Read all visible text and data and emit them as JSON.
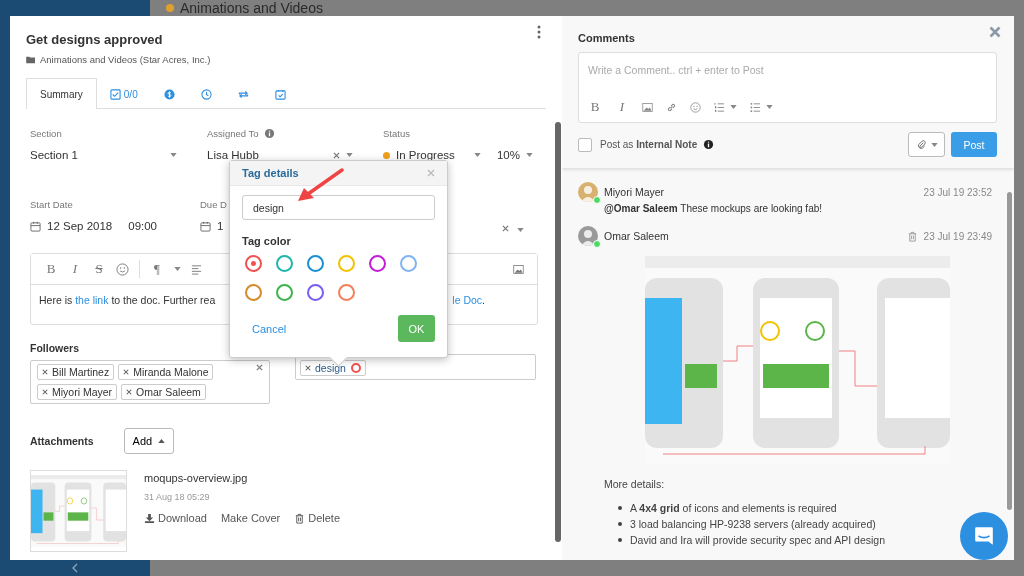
{
  "background": {
    "project_title": "Animations and Videos"
  },
  "task": {
    "title": "Get designs approved",
    "breadcrumb": "Animations and Videos (Star Acres, Inc.)",
    "tabs": [
      {
        "kind": "summary",
        "label": "Summary",
        "selected": true
      },
      {
        "kind": "checklist",
        "label": "0/0",
        "selected": false
      },
      {
        "kind": "billing",
        "selected": false
      },
      {
        "kind": "time",
        "selected": false
      },
      {
        "kind": "recurrence",
        "selected": false
      },
      {
        "kind": "schedule",
        "selected": false
      }
    ],
    "fields": [
      {
        "kind": "select",
        "label": "Section",
        "value": "Section 1"
      },
      {
        "kind": "assignee",
        "label": "Assigned To",
        "value": "Lisa Hubb"
      },
      {
        "kind": "status",
        "label": "Status",
        "value": "In Progress",
        "color": "#f0a020",
        "percent": "10%"
      }
    ],
    "dates": [
      {
        "label": "Start Date",
        "date": "12 Sep 2018",
        "time": "09:00"
      },
      {
        "label": "Due D",
        "date": "1"
      }
    ],
    "editor": {
      "glyphs": [
        "B",
        "I",
        "S"
      ],
      "paragraph": "¶",
      "before": "Here is ",
      "link": "the link",
      "after": " to the doc. Further rea",
      "tail_link": "le Doc",
      "tail": "."
    },
    "followers": {
      "label": "Followers",
      "people": [
        "Bill Martinez",
        "Miranda Malone",
        "Miyori Mayer",
        "Omar Saleem"
      ]
    },
    "tags": [
      {
        "name": "design",
        "color": "#f0524f"
      }
    ],
    "attachments": {
      "label": "Attachments",
      "add_button": "Add",
      "files": [
        {
          "name": "moqups-overview.jpg",
          "date": "31 Aug 18 05:29",
          "actions": [
            {
              "kind": "download",
              "label": "Download"
            },
            {
              "kind": "cover",
              "label": "Make Cover"
            },
            {
              "kind": "delete",
              "label": "Delete"
            }
          ]
        }
      ]
    }
  },
  "tag_popup": {
    "title": "Tag details",
    "value": "design",
    "color_label": "Tag color",
    "colors": [
      {
        "color": "#f0524f",
        "selected": true
      },
      {
        "color": "#1fb5a8",
        "selected": false
      },
      {
        "color": "#1a8ed1",
        "selected": false
      },
      {
        "color": "#f2c200",
        "selected": false
      },
      {
        "color": "#c21fd6",
        "selected": false
      },
      {
        "color": "#7fb4f0",
        "selected": false
      },
      {
        "color": "#d68a2c",
        "selected": false
      },
      {
        "color": "#3cb44b",
        "selected": false
      },
      {
        "color": "#7b5cf5",
        "selected": false
      },
      {
        "color": "#f47e5a",
        "selected": false
      }
    ],
    "cancel": "Cancel",
    "ok": "OK"
  },
  "comments_panel": {
    "title": "Comments",
    "placeholder": "Write a Comment.. ctrl + enter to Post",
    "glyphs": [
      "B",
      "I"
    ],
    "internal_note": {
      "text": "Post as **Internal Note**",
      "checked": false
    },
    "post_button": "Post",
    "comments": [
      {
        "author": "Miyori Mayer",
        "time": "23 Jul 19 23:52",
        "online": true,
        "deletable": false,
        "body": "**@Omar Saleem** These mockups are looking fab!"
      },
      {
        "author": "Omar Saleem",
        "time": "23 Jul 19 23:49",
        "online": true,
        "deletable": true,
        "attachment": {
          "kind": "picture"
        },
        "details_title": "More details:",
        "bullets": [
          "A **4x4 grid** of icons and elements is required",
          "3 load balancing HP-9238 servers (already acquired)",
          "David and Ira will provide security spec and API design"
        ]
      }
    ]
  }
}
